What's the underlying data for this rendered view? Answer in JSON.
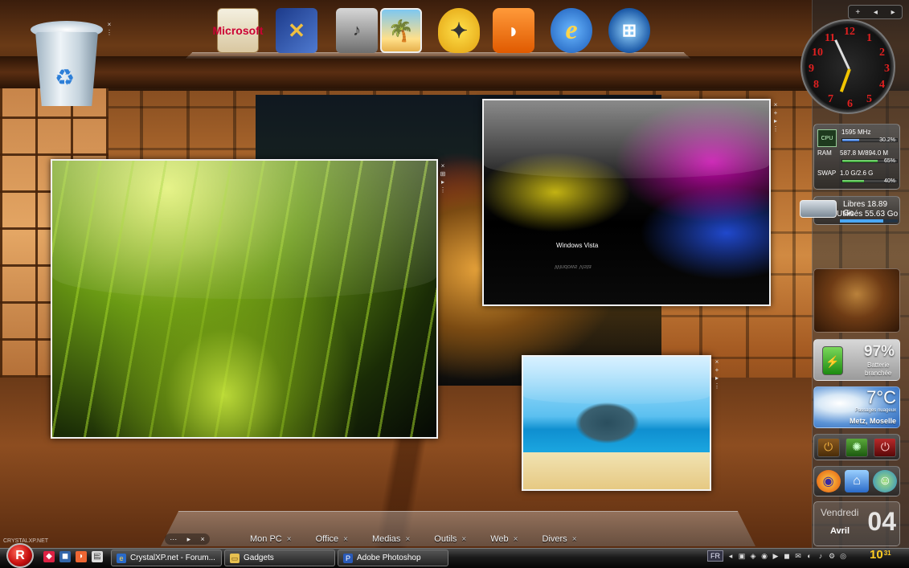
{
  "desktop": {
    "recycle_bin": {
      "icon": "recycle-bin-icon"
    },
    "brand_text": "CRYSTALXP.NET"
  },
  "dock": {
    "items": [
      {
        "name": "Microsoft Office",
        "icon": "office-icon",
        "glyph": "Microsoft"
      },
      {
        "name": "Tools",
        "icon": "tools-icon",
        "glyph": "✕"
      },
      {
        "name": "Media player",
        "icon": "media-player-icon",
        "glyph": "♪"
      },
      {
        "name": "Photos",
        "icon": "photo-icon",
        "glyph": "🌴"
      },
      {
        "name": "Games",
        "icon": "games-icon",
        "glyph": "✦"
      },
      {
        "name": "RSS",
        "icon": "rss-icon",
        "glyph": "◗"
      },
      {
        "name": "Internet Explorer",
        "icon": "internet-explorer-icon",
        "glyph": "e"
      },
      {
        "name": "Windows",
        "icon": "windows-icon",
        "glyph": "⊞"
      }
    ]
  },
  "frames": {
    "vista_text": "Windows Vista"
  },
  "shelf": {
    "tabs": [
      "Mon PC",
      "Office",
      "Medias",
      "Outils",
      "Web",
      "Divers"
    ],
    "close_glyph": "×"
  },
  "sidebar": {
    "controls": [
      "+",
      "◂",
      "▸"
    ],
    "clock_numerals": [
      "12",
      "1",
      "2",
      "3",
      "4",
      "5",
      "6",
      "7",
      "8",
      "9",
      "10",
      "11"
    ],
    "system": {
      "cpu_label": "CPU",
      "cpu_freq": "1595 MHz",
      "cpu_pct": "30.2%",
      "cpu_fill": 0.302,
      "ram_label": "RAM",
      "ram_value": "587.8 M/894.0 M",
      "ram_pct": "65%",
      "ram_fill": 0.65,
      "swap_label": "SWAP",
      "swap_value": "1.0 G/2.6 G",
      "swap_pct": "40%",
      "swap_fill": 0.4
    },
    "disk": {
      "free": "Libres 18.89 Go",
      "used": "Utilisés 55.63 Go",
      "used_fill": 0.75
    },
    "battery": {
      "percent": "97%",
      "line1": "Batterie",
      "line2": "branchée"
    },
    "weather": {
      "temp": "7°C",
      "condition": "Passages nuageux",
      "city": "Metz, Moselle"
    },
    "calendar": {
      "day": "Vendredi",
      "month": "Avril",
      "date": "04"
    }
  },
  "taskbar": {
    "start_glyph": "R",
    "quick_launch_more": "»",
    "tasks": [
      {
        "label": "CrystalXP.net - Forum...",
        "icon": "internet-explorer-icon"
      },
      {
        "label": "Gadgets",
        "icon": "folder-icon"
      },
      {
        "label": "Adobe Photoshop",
        "icon": "photoshop-icon"
      }
    ],
    "language": "FR",
    "time_hours": "10",
    "time_minutes": "31"
  }
}
